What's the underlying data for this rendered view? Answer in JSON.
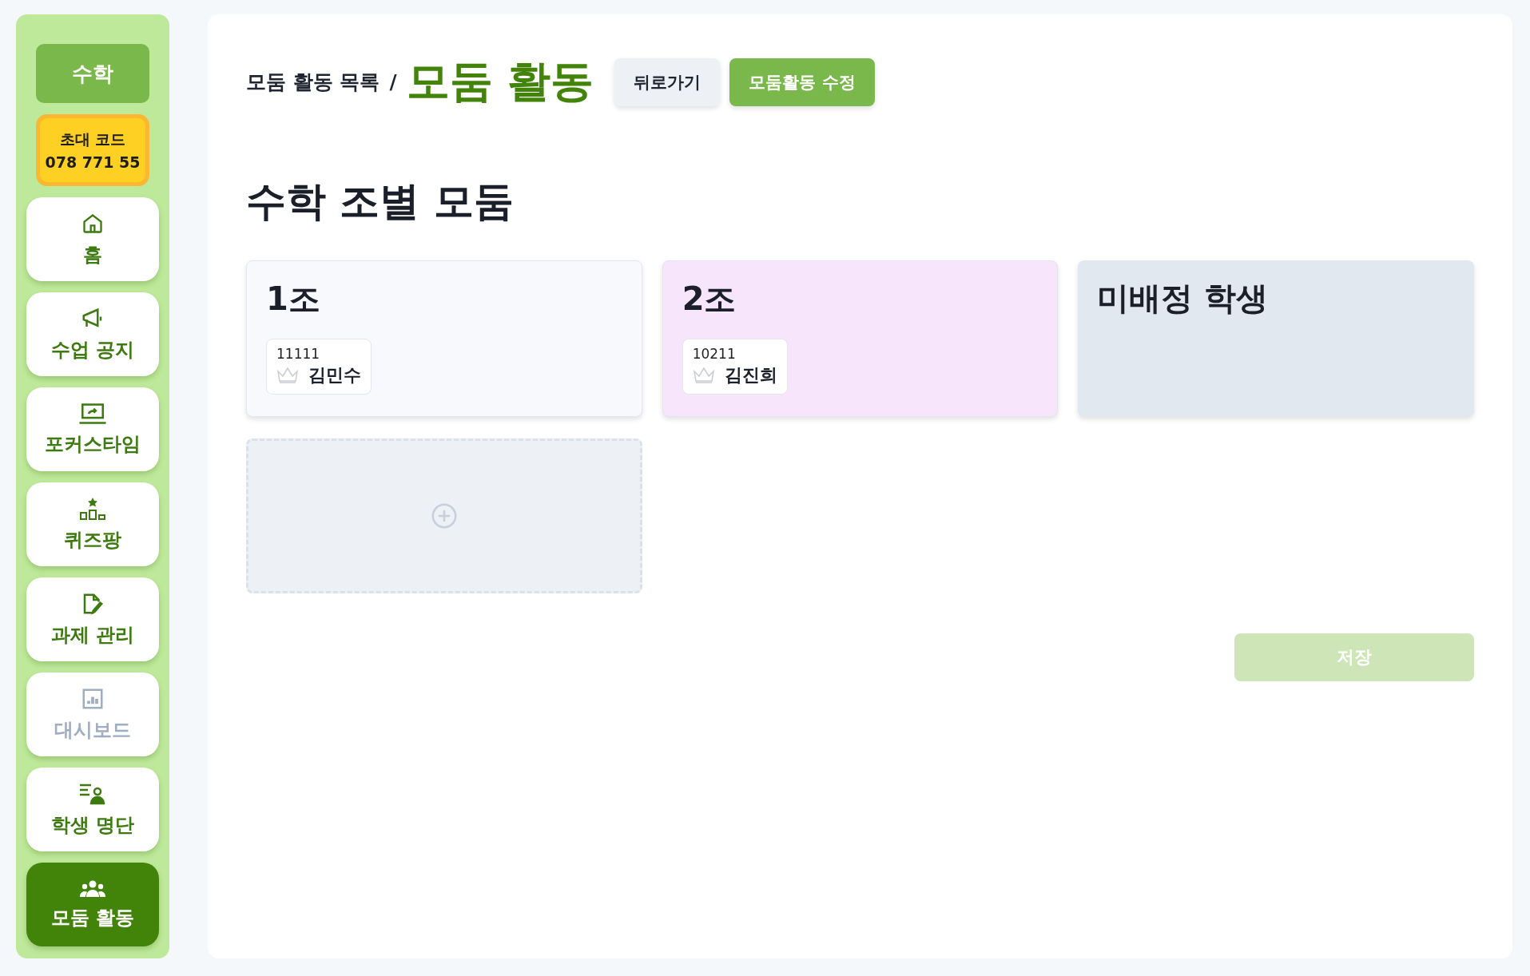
{
  "sidebar": {
    "subject": "수학",
    "invite": {
      "label": "초대 코드",
      "code": "078 771 55"
    },
    "items": [
      {
        "label": "홈",
        "selected": false,
        "disabled": false
      },
      {
        "label": "수업 공지",
        "selected": false,
        "disabled": false
      },
      {
        "label": "포커스타임",
        "selected": false,
        "disabled": false
      },
      {
        "label": "퀴즈팡",
        "selected": false,
        "disabled": false
      },
      {
        "label": "과제 관리",
        "selected": false,
        "disabled": false
      },
      {
        "label": "대시보드",
        "selected": false,
        "disabled": true
      },
      {
        "label": "학생 명단",
        "selected": false,
        "disabled": false
      },
      {
        "label": "모둠 활동",
        "selected": true,
        "disabled": false
      }
    ]
  },
  "header": {
    "breadcrumb": "모둠 활동 목록",
    "separator": "/",
    "title": "모둠 활동",
    "buttons": [
      {
        "label": "뒤로가기",
        "kind": "secondary"
      },
      {
        "label": "모둠활동 수정",
        "kind": "primary"
      }
    ]
  },
  "heading": "수학 조별 모둠",
  "groups": [
    {
      "title": "1조",
      "color": "#f8f9fc",
      "students": [
        {
          "number": "11111",
          "name": "김민수",
          "leader": false
        }
      ]
    },
    {
      "title": "2조",
      "color": "#f7e5fb",
      "students": [
        {
          "number": "10211",
          "name": "김진희",
          "leader": false
        }
      ]
    }
  ],
  "unassigned": {
    "title": "미배정 학생",
    "color": "#e2e8f0"
  },
  "save_button": {
    "label": "저장",
    "disabled": true
  }
}
